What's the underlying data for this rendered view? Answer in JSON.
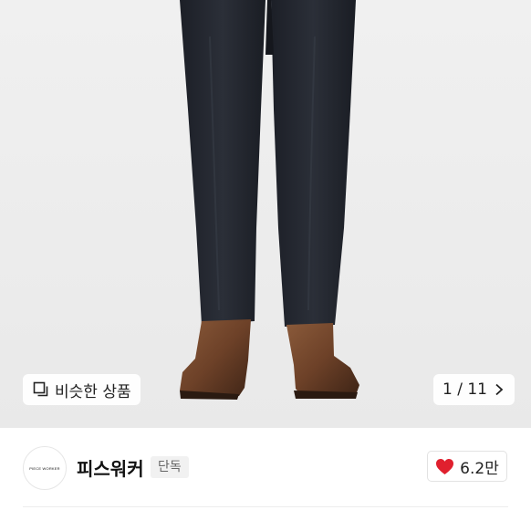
{
  "gallery": {
    "similar_label": "비슷한 상품",
    "similar_icon": "similar-products-icon",
    "counter": "1 / 11",
    "next_icon": "chevron-right-icon"
  },
  "brand": {
    "logo_text": "PIECE WORKER",
    "name": "피스워커",
    "badge": "단독"
  },
  "like": {
    "icon": "heart-icon",
    "color": "#e0202e",
    "count": "6.2만"
  }
}
